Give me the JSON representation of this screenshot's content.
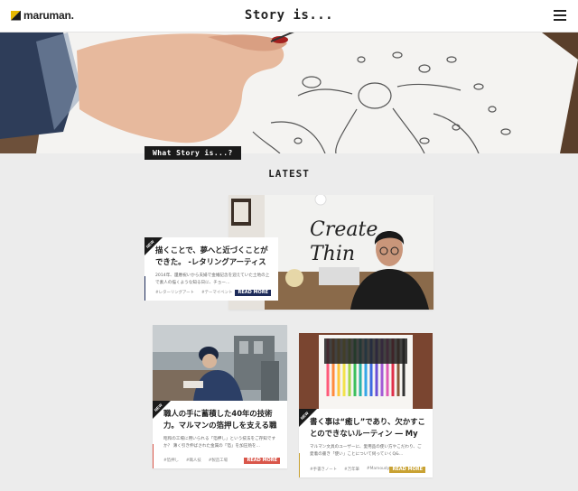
{
  "header": {
    "logo_text": "maruman.",
    "title": "Story is...",
    "menu_icon": "hamburger-menu-icon"
  },
  "hero": {
    "tag_label": "What Story is...?"
  },
  "section": {
    "heading": "LATEST"
  },
  "colors": {
    "background": "#ececec",
    "read_more_navy": "#1d2b5a",
    "read_more_red": "#d9564a",
    "read_more_gold": "#c9a233",
    "badge": "#1a1a1a"
  },
  "cards": [
    {
      "badge": "NEW",
      "title": "描くことで、夢へと近づくことができた。 -レタリングアーティスト …",
      "excerpt": "2014年、還暦祝いから夫婦で金婚記念を迎えていた土地の上で素人の描くような知る日に、チョー…",
      "tags": [
        "#レターリングアート",
        "#テーマイベント"
      ],
      "read_more": "READ MORE"
    },
    {
      "badge": "NEW",
      "title": "職人の手に蓄積した40年の技術力。マルマンの箔押しを支える職人（…",
      "excerpt": "昭和の工場に用いられる「箔押し」という技法をご存知ですか？ 薄く引き伸ばされた金属の「箔」を加圧熱を…",
      "tags": [
        "#箔押し",
        "#職人技",
        "#製造工場"
      ],
      "read_more": "READ MORE"
    },
    {
      "badge": "NEW",
      "title": "書く事は“癒し”であり、欠かすことのできないルーティン ― My …",
      "excerpt": "マルマン文具のユーザーに、愛用品の使い方やこだわり、ご愛着の書き「使い」ことについて伺っていくQ&…",
      "tags": [
        "#手書きノート",
        "#万年筆",
        "#Mamoudya"
      ],
      "read_more": "READ MORE"
    }
  ]
}
